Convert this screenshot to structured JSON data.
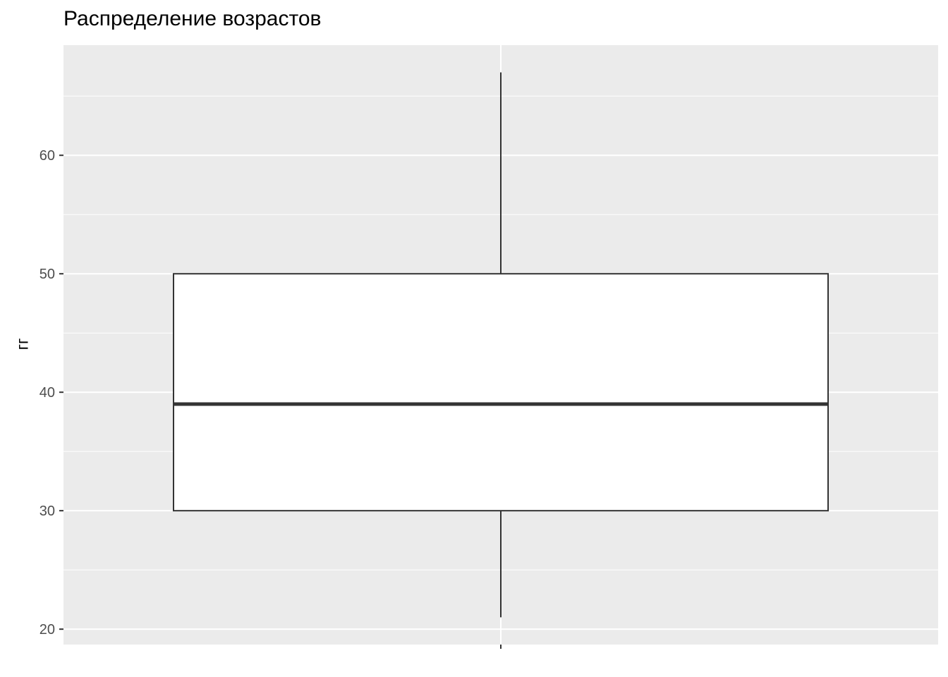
{
  "chart_data": {
    "type": "boxplot",
    "title": "Распределение возрастов",
    "xlabel": "",
    "ylabel": "гг",
    "ylim": [
      18.7,
      69.3
    ],
    "y_ticks": [
      20,
      30,
      40,
      50,
      60
    ],
    "y_tick_labels": [
      "20",
      "30",
      "40",
      "50",
      "60"
    ],
    "grid": true,
    "boxes": [
      {
        "whisker_low": 21,
        "q1": 30,
        "median": 39,
        "q3": 50,
        "whisker_high": 67
      }
    ],
    "colors": {
      "panel_background": "#EBEBEB",
      "grid_line": "#FFFFFF",
      "box_fill": "#FFFFFF",
      "box_line": "#333333",
      "tick_text": "#4D4D4D"
    }
  }
}
